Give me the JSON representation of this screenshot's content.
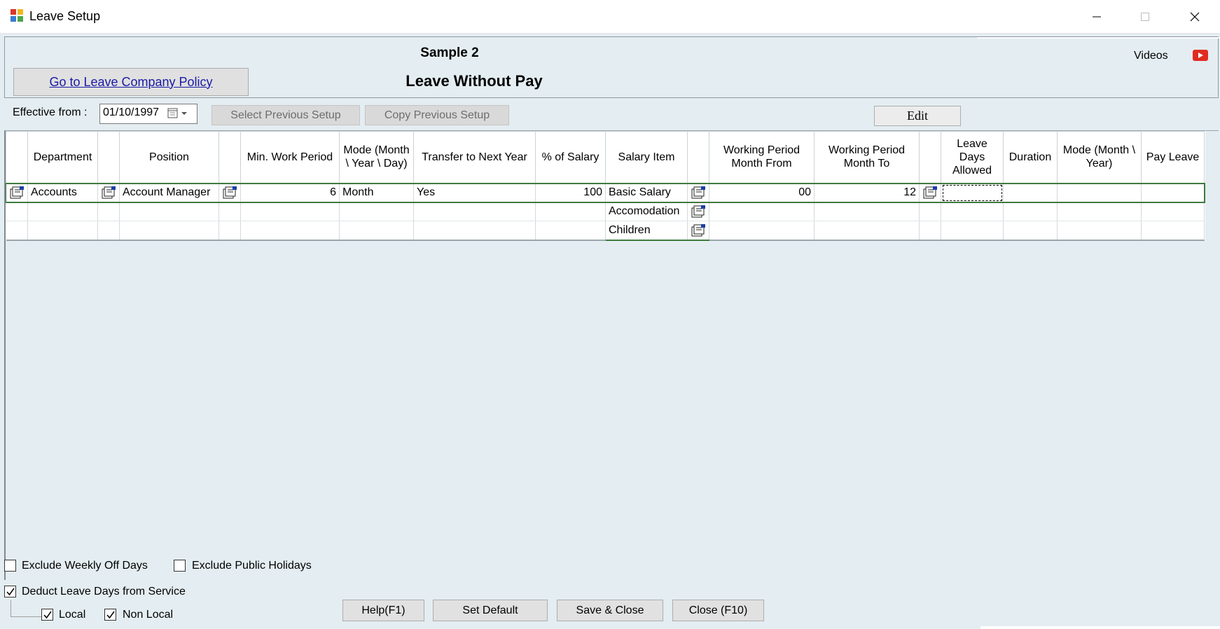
{
  "window": {
    "title": "Leave Setup"
  },
  "header": {
    "company": "Sample 2",
    "leave_type": "Leave Without Pay",
    "policy_link": "Go to Leave Company Policy",
    "videos_label": "Videos",
    "video_icon": "youtube-icon"
  },
  "toolbar": {
    "effective_label": "Effective from :",
    "effective_date": "01/10/1997",
    "select_previous": "Select Previous Setup",
    "copy_previous": "Copy Previous Setup",
    "edit": "Edit"
  },
  "grid": {
    "columns": [
      "",
      "Department",
      "",
      "Position",
      "",
      "Min. Work Period",
      "Mode (Month \\ Year \\ Day)",
      "Transfer to Next Year",
      "% of Salary",
      "Salary Item",
      "",
      "Working Period Month From",
      "Working Period Month To",
      "",
      "Leave Days Allowed",
      "Duration",
      "Mode (Month \\ Year)",
      "Pay Leave"
    ],
    "rows": [
      {
        "department": "Accounts",
        "position": "Account Manager",
        "min_work_period": "6",
        "mode": "Month",
        "transfer": "Yes",
        "pct_salary": "100",
        "salary_item": "Basic Salary",
        "wp_from": "00",
        "wp_to": "12",
        "leave_days": "",
        "duration": "",
        "mode_my": "",
        "pay_leave": ""
      },
      {
        "salary_item": "Accomodation"
      },
      {
        "salary_item": "Children"
      }
    ]
  },
  "options": {
    "exclude_weekly_off": {
      "label": "Exclude Weekly Off Days",
      "checked": false
    },
    "exclude_public_holidays": {
      "label": "Exclude Public Holidays",
      "checked": false
    },
    "deduct_leave_days": {
      "label": "Deduct Leave Days from Service",
      "checked": true
    },
    "local": {
      "label": "Local",
      "checked": true
    },
    "non_local": {
      "label": "Non Local",
      "checked": true
    }
  },
  "buttons": {
    "help": "Help(F1)",
    "set_default": "Set Default",
    "save_close": "Save & Close",
    "close": "Close (F10)"
  }
}
